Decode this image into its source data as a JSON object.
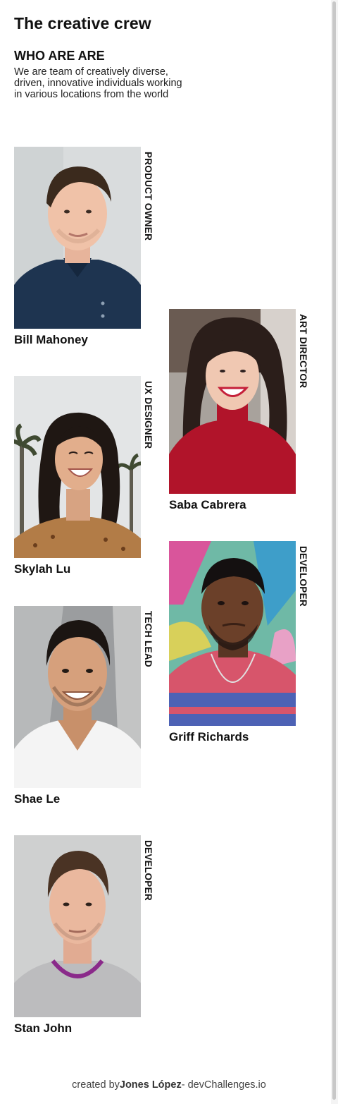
{
  "page": {
    "title": "The creative crew",
    "subtitle": "WHO ARE ARE",
    "intro": "We are team of creatively diverse, driven, innovative individuals working in various locations from the world"
  },
  "members": [
    {
      "name": "Bill Mahoney",
      "role": "PRODUCT OWNER",
      "photo_icon": "portrait-man-navy-polo"
    },
    {
      "name": "Saba Cabrera",
      "role": "ART DIRECTOR",
      "photo_icon": "portrait-woman-red-sweater"
    },
    {
      "name": "Skylah Lu",
      "role": "UX DESIGNER",
      "photo_icon": "portrait-woman-palm-trees"
    },
    {
      "name": "Griff Richards",
      "role": "DEVELOPER",
      "photo_icon": "portrait-man-colorful-wall"
    },
    {
      "name": "Shae Le",
      "role": "TECH LEAD",
      "photo_icon": "portrait-man-white-tee"
    },
    {
      "name": "Stan John",
      "role": "DEVELOPER",
      "photo_icon": "portrait-man-grey-sweater"
    }
  ],
  "footer": {
    "prefix": "created by",
    "author": "Jones López",
    "suffix": "- devChallenges.io"
  },
  "colors": {
    "background": "#ffffff",
    "text": "#111111",
    "scrollbar_thumb": "#c8c8c8"
  }
}
